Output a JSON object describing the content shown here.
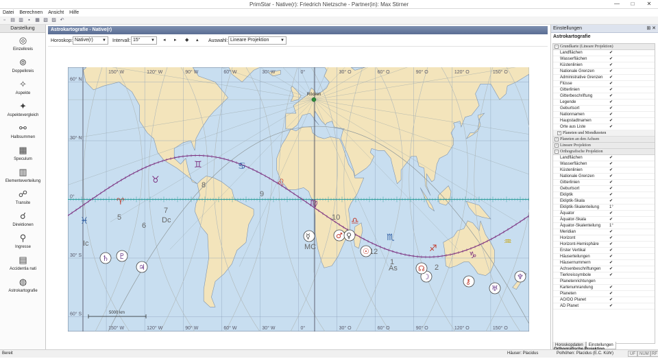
{
  "window": {
    "title": "PrimStar - Native(r): Friedrich Nietzsche - Partner(in): Max Stirner",
    "minimize": "—",
    "maximize": "□",
    "close": "✕"
  },
  "menu": [
    "Datei",
    "Berechnen",
    "Ansicht",
    "Hilfe"
  ],
  "toolbar_icons": [
    "new-icon",
    "open-icon",
    "open-folder-icon",
    "save-icon",
    "save-all-icon",
    "print-icon",
    "print-preview-icon",
    "undo-icon"
  ],
  "toolbar_glyphs": [
    "▫",
    "▤",
    "▥",
    "▪",
    "▦",
    "▧",
    "▨",
    "↶"
  ],
  "left_panel": {
    "header": "Darstellung",
    "items": [
      {
        "label": "Einzelkreis",
        "glyph": "◎"
      },
      {
        "label": "Doppelkreis",
        "glyph": "⊚"
      },
      {
        "label": "Aspekte",
        "glyph": "✧"
      },
      {
        "label": "Aspektevergleich",
        "glyph": "✦"
      },
      {
        "label": "Halbsummen",
        "glyph": "⚯"
      },
      {
        "label": "Speculum",
        "glyph": "▦"
      },
      {
        "label": "Elementeverteilung",
        "glyph": "▥"
      },
      {
        "label": "Transite",
        "glyph": "☍"
      },
      {
        "label": "Direktionen",
        "glyph": "☌"
      },
      {
        "label": "Ingresse",
        "glyph": "⚲"
      },
      {
        "label": "Accidentia nati",
        "glyph": "▤"
      },
      {
        "label": "Astrokartografie",
        "glyph": "◍"
      }
    ]
  },
  "document": {
    "tab_title": "Astrokartografie - Native(r)",
    "controls": {
      "horoskop_label": "Horoskop:",
      "horoskop_value": "Native(r)",
      "intervall_label": "Intervall:",
      "intervall_value": "15°",
      "auswahl_label": "Auswahl:",
      "auswahl_value": "Lineare Projektion",
      "nav": [
        "◂",
        "▸",
        "◆",
        "▴",
        "▾"
      ]
    }
  },
  "map": {
    "top_labels": [
      "150° W",
      "120° W",
      "90° W",
      "60° W",
      "30° W",
      "0°",
      "30° O",
      "60° O",
      "90° O",
      "120° O",
      "150° O"
    ],
    "bottom_labels": [
      "150° W",
      "120° W",
      "90° W",
      "60° W",
      "30° W",
      "0°",
      "30° O",
      "60° O",
      "90° O",
      "120° O",
      "150° O"
    ],
    "side_labels": [
      "60° N",
      "30° N",
      "0°",
      "30° S",
      "60° S"
    ],
    "place_label": "Röcken",
    "scale_label": "5000 km",
    "house_labels": [
      "Ic",
      "6",
      "7",
      "Dc",
      "8",
      "9",
      "MC",
      "11",
      "12",
      "1",
      "As",
      "2",
      "5",
      "10"
    ],
    "zodiac_glyphs": [
      "♓",
      "♈",
      "♉",
      "♊",
      "♋",
      "♌",
      "♍",
      "♎",
      "♏",
      "♐",
      "♑",
      "♒"
    ],
    "planets": [
      {
        "name": "Saturn",
        "glyph": "♄",
        "color": "#6b3a8a"
      },
      {
        "name": "Merkur",
        "glyph": "☿",
        "color": "#444444"
      },
      {
        "name": "Mars",
        "glyph": "♂",
        "color": "#c0392b"
      },
      {
        "name": "Venus",
        "glyph": "♀",
        "color": "#444444"
      },
      {
        "name": "Sonne",
        "glyph": "☉",
        "color": "#c0392b"
      },
      {
        "name": "Mond",
        "glyph": "☽",
        "color": "#6b3a8a"
      },
      {
        "name": "Mondknoten",
        "glyph": "☊",
        "color": "#c0392b"
      },
      {
        "name": "Jupiter",
        "glyph": "♃",
        "color": "#6b3a8a"
      },
      {
        "name": "Uranus",
        "glyph": "♅",
        "color": "#6b3a8a"
      },
      {
        "name": "Neptun",
        "glyph": "♆",
        "color": "#6b3a8a"
      },
      {
        "name": "Pluto",
        "glyph": "♇",
        "color": "#6b3a8a"
      },
      {
        "name": "Chiron",
        "glyph": "⚷",
        "color": "#c0392b"
      }
    ],
    "colors": {
      "ocean": "#c8def0",
      "land": "#f3e4bb",
      "ecliptic": "#7b2f7f",
      "equator": "#2a9b9b",
      "grid": "#8aa0b8",
      "planet_lines": "#b0b8b8"
    }
  },
  "right_panel": {
    "title": "Einstellungen",
    "subtitle": "Astrokartografie",
    "sections": [
      {
        "title": "Grundkarte (Lineare Projektion)",
        "expanded": true,
        "rows": [
          {
            "label": "Landflächen",
            "value": "✔"
          },
          {
            "label": "Wasserflächen",
            "value": "✔"
          },
          {
            "label": "Küstenlinien",
            "value": "✔"
          },
          {
            "label": "Nationale Grenzen",
            "value": "✔"
          },
          {
            "label": "Administrative Grenzen",
            "value": "✔"
          },
          {
            "label": "Flüsse",
            "value": "✔"
          },
          {
            "label": "Gitterlinien",
            "value": "✔"
          },
          {
            "label": "Gitterbeschriftung",
            "value": "✔"
          },
          {
            "label": "Legende",
            "value": "✔"
          },
          {
            "label": "Geburtsort",
            "value": "✔"
          },
          {
            "label": "Nationnamen",
            "value": "✔"
          },
          {
            "label": "Haupstadtnamen",
            "value": "✔"
          },
          {
            "label": "Orte aus Liste",
            "value": "✔"
          }
        ],
        "sub": "Planeten und Mondknoten"
      },
      {
        "title": "Planeten an den Achsen",
        "expanded": false,
        "rows": []
      },
      {
        "title": "Lineare Projektion",
        "expanded": false,
        "rows": []
      },
      {
        "title": "Orthografische Projektion",
        "expanded": true,
        "rows": [
          {
            "label": "Landflächen",
            "value": "✔"
          },
          {
            "label": "Wasserflächen",
            "value": "✔"
          },
          {
            "label": "Küstenlinien",
            "value": "✔"
          },
          {
            "label": "Nationale Grenzen",
            "value": "✔"
          },
          {
            "label": "Gitterlinien",
            "value": "✔"
          },
          {
            "label": "Geburtsort",
            "value": "✔"
          },
          {
            "label": "Ekliptik",
            "value": "✔"
          },
          {
            "label": "Ekliptik-Skala",
            "value": "✔"
          },
          {
            "label": "Ekliptik-Skalenteilung",
            "value": "1°"
          },
          {
            "label": "Äquator",
            "value": "✔"
          },
          {
            "label": "Äquator-Skala",
            "value": "✔"
          },
          {
            "label": "Äquator-Skalenteilung",
            "value": "1°"
          },
          {
            "label": "Meridian",
            "value": "✔"
          },
          {
            "label": "Horizont",
            "value": "✔"
          },
          {
            "label": "Horizont-Hemisphäre",
            "value": "✔"
          },
          {
            "label": "Erster Vertikal",
            "value": "✔"
          },
          {
            "label": "Häuserteilungen",
            "value": "✔"
          },
          {
            "label": "Häusernummern",
            "value": "✔"
          },
          {
            "label": "Achsenbeschriftungen",
            "value": "✔"
          },
          {
            "label": "Tierkreissymbole",
            "value": "✔"
          },
          {
            "label": "Planetenrichtungen",
            "value": ""
          },
          {
            "label": "Kartenumrandung",
            "value": "✔"
          },
          {
            "label": "Planeten",
            "value": "✔"
          },
          {
            "label": "AO/DO Planet",
            "value": "✔"
          },
          {
            "label": "AD Planet",
            "value": "✔"
          }
        ]
      }
    ],
    "description_title": "Orthografische Projektion",
    "tabs": [
      "Horoskopdaten",
      "Einstellungen"
    ]
  },
  "statusbar": {
    "left": "Bereit",
    "houses": "Häuser: Placidus",
    "poles": "Polhöhen: Placidus (E.C. Kühr)",
    "keys": [
      "UF",
      "NUM",
      "RF"
    ]
  }
}
